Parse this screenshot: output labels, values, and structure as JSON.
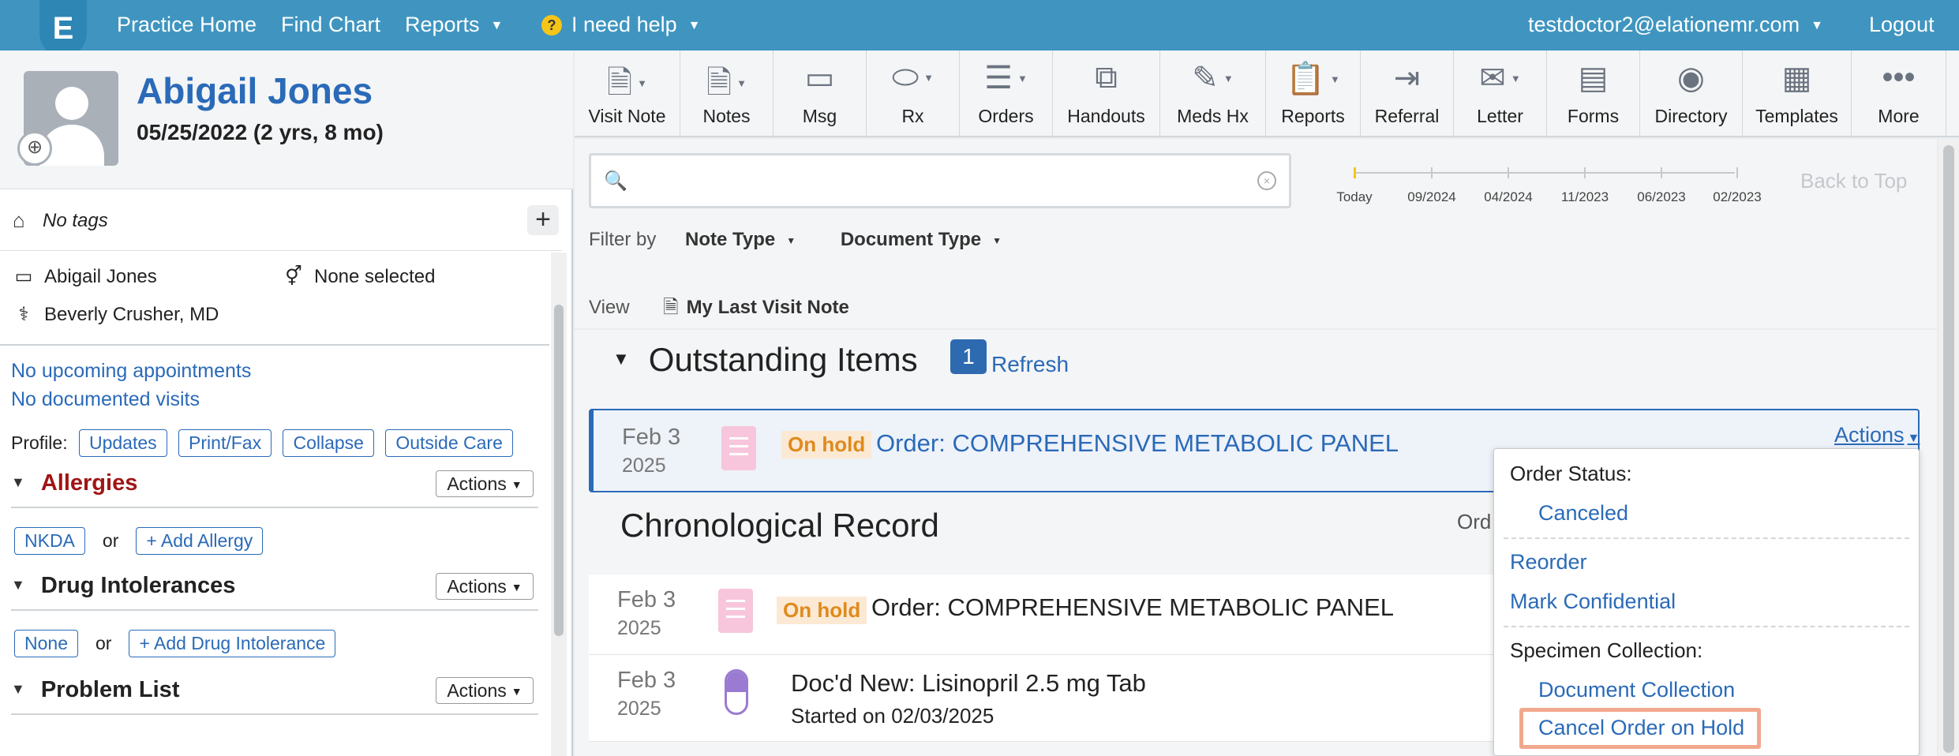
{
  "topbar": {
    "logo": "E",
    "nav": [
      "Practice Home",
      "Find Chart",
      "Reports",
      "I need help"
    ],
    "user": "testdoctor2@elationemr.com",
    "logout": "Logout"
  },
  "patient": {
    "name": "Abigail Jones",
    "dob": "05/25/2022 (2 yrs, 8 mo)",
    "tags": "No tags",
    "id_name": "Abigail Jones",
    "gender": "None selected",
    "provider": "Beverly Crusher, MD",
    "appointments": "No upcoming appointments",
    "visits": "No documented visits",
    "profile_label": "Profile:",
    "profile_buttons": [
      "Updates",
      "Print/Fax",
      "Collapse",
      "Outside Care"
    ]
  },
  "sections": {
    "allergies": {
      "title": "Allergies",
      "actions": "Actions",
      "btn1": "NKDA",
      "or": "or",
      "btn2": "+ Add Allergy"
    },
    "intolerances": {
      "title": "Drug Intolerances",
      "actions": "Actions",
      "btn1": "None",
      "or": "or",
      "btn2": "+ Add Drug Intolerance"
    },
    "problems": {
      "title": "Problem List",
      "actions": "Actions"
    }
  },
  "toolbar": [
    "Visit Note",
    "Notes",
    "Msg",
    "Rx",
    "Orders",
    "Handouts",
    "Meds Hx",
    "Reports",
    "Referral",
    "Letter",
    "Forms",
    "Directory",
    "Templates",
    "More"
  ],
  "timeline": [
    "Today",
    "09/2024",
    "04/2024",
    "11/2023",
    "06/2023",
    "02/2023"
  ],
  "back_to_top": "Back to Top",
  "filter": {
    "label": "Filter by",
    "note_type": "Note Type",
    "doc_type": "Document Type"
  },
  "view": {
    "label": "View",
    "value": "My Last Visit Note"
  },
  "outstanding": {
    "title": "Outstanding Items",
    "count": "1",
    "refresh": "Refresh",
    "item": {
      "month_day": "Feb 3",
      "year": "2025",
      "status": "On hold",
      "title": "Order: COMPREHENSIVE METABOLIC PANEL",
      "actions": "Actions"
    }
  },
  "chronological": {
    "title": "Chronological Record",
    "partial": "Ord",
    "rows": [
      {
        "month_day": "Feb 3",
        "year": "2025",
        "status": "On hold",
        "title": "Order: COMPREHENSIVE METABOLIC PANEL"
      },
      {
        "month_day": "Feb 3",
        "year": "2025",
        "title": "Doc'd New: Lisinopril 2.5 mg Tab",
        "sub": "Started on 02/03/2025"
      }
    ]
  },
  "dropdown": {
    "order_status": "Order Status:",
    "canceled": "Canceled",
    "reorder": "Reorder",
    "confidential": "Mark Confidential",
    "specimen": "Specimen Collection:",
    "doc_collection": "Document Collection",
    "cancel_hold": "Cancel Order on Hold"
  }
}
